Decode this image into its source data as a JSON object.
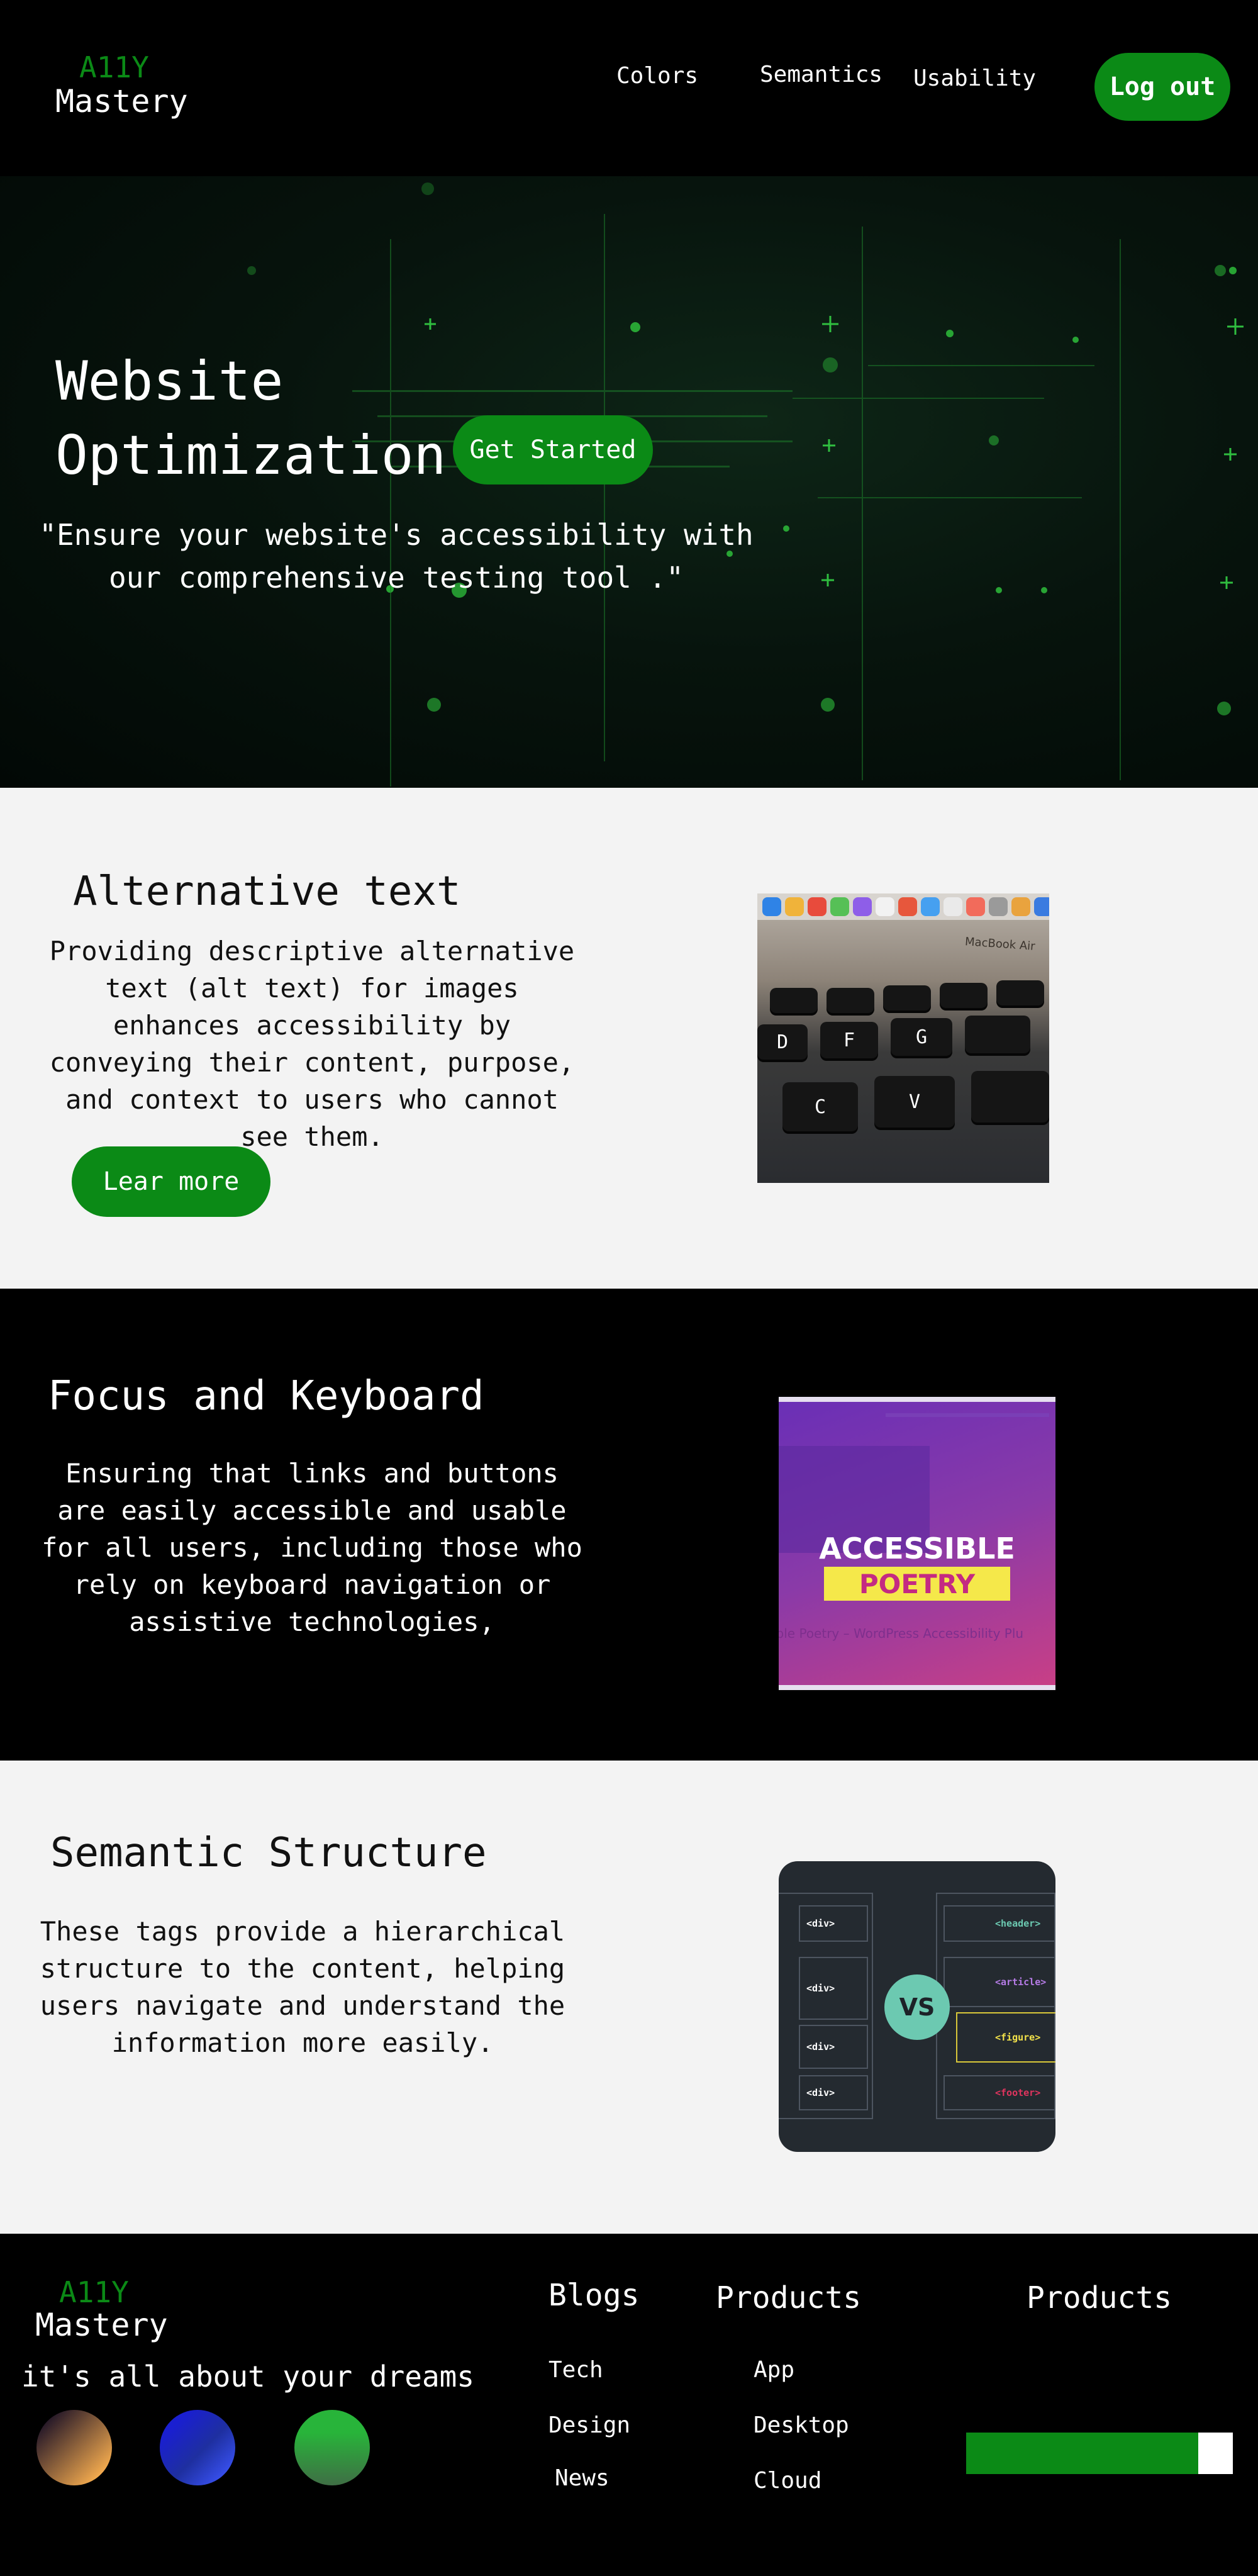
{
  "header": {
    "logo_top": "A11Y",
    "logo_bottom": "Mastery",
    "nav": [
      "Colors",
      "Semantics",
      "Usability"
    ],
    "logout_label": "Log out"
  },
  "hero": {
    "title_line1": "Website",
    "title_line2": "Optimization",
    "cta_label": "Get Started",
    "quote": "\"Ensure your website's accessibility with our comprehensive testing tool .\""
  },
  "sections": {
    "alt_text": {
      "title": "Alternative text",
      "text": "Providing descriptive alternative text (alt text) for images enhances accessibility by conveying their content, purpose, and context to users who cannot see them.",
      "button_label": "Lear more",
      "image": {
        "brand": "MacBook Air",
        "keys": [
          "D",
          "F",
          "G",
          "C",
          "V"
        ]
      }
    },
    "focus": {
      "title": "Focus and Keyboard",
      "text": "Ensuring that links and buttons are easily accessible and usable for all users, including those who rely on keyboard navigation or assistive technologies,",
      "image": {
        "line1": "ACCESSIBLE",
        "line2": "POETRY",
        "caption": "ible Poetry – WordPress Accessibility Plu"
      }
    },
    "semantic": {
      "title": "Semantic Structure",
      "text": "These tags provide a hierarchical structure to the content, helping users navigate and understand the information more easily.",
      "image": {
        "left_tags": [
          "<div>",
          "<div>",
          "<div>",
          "<div>"
        ],
        "right_tags": [
          "<header>",
          "<article>",
          "<figure>",
          "<footer>"
        ],
        "vs": "VS"
      }
    }
  },
  "footer": {
    "logo_top": "A11Y",
    "logo_bottom": "Mastery",
    "tagline": "it's all about your dreams",
    "blogs": {
      "heading": "Blogs",
      "links": [
        "Tech",
        "Design",
        "News"
      ]
    },
    "products": {
      "heading": "Products",
      "links": [
        "App",
        "Desktop",
        "Cloud"
      ]
    },
    "products2": {
      "heading": "Products",
      "progress": 0.87
    },
    "colors": {
      "accent": "#0b8a16"
    }
  }
}
